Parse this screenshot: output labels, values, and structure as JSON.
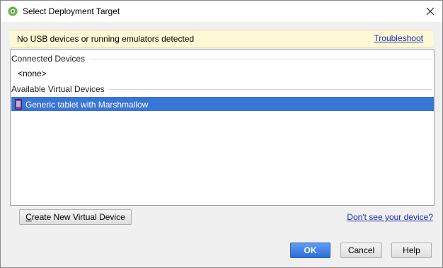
{
  "window": {
    "title": "Select Deployment Target"
  },
  "banner": {
    "message": "No USB devices or running emulators detected",
    "link_label": "Troubleshoot"
  },
  "connected": {
    "header": "Connected Devices",
    "items": [
      "<none>"
    ]
  },
  "available": {
    "header": "Available Virtual Devices",
    "items": [
      {
        "label": "Generic tablet with Marshmallow",
        "selected": true,
        "icon": "tablet-icon"
      }
    ]
  },
  "actions": {
    "create_prefix": "C",
    "create_rest": "reate New Virtual Device",
    "help_link": "Don't see your device?",
    "ok": "OK",
    "cancel": "Cancel",
    "help": "Help"
  },
  "colors": {
    "selection": "#3875d7",
    "banner_bg": "#fdf9d5",
    "link": "#1a2cb8",
    "ok_button": "#3d7fe0"
  }
}
